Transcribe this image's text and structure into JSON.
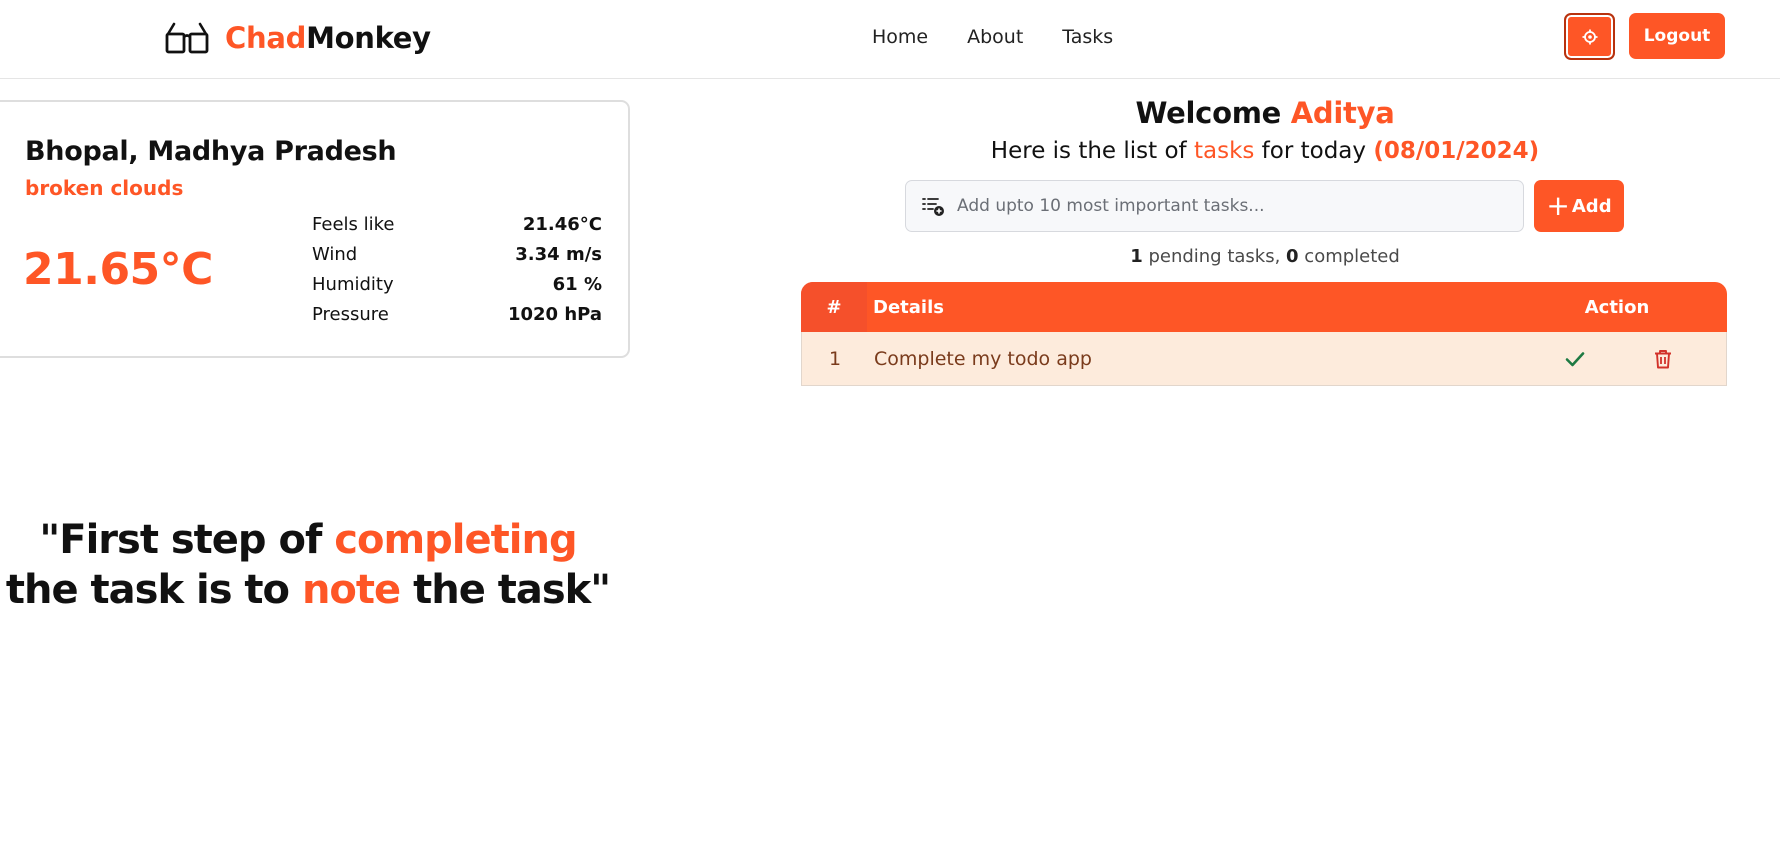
{
  "app": {
    "brand_part1": "Chad",
    "brand_part2": "Monkey",
    "accent_color": "#fe5626"
  },
  "nav": {
    "items": [
      {
        "label": "Home"
      },
      {
        "label": "About"
      },
      {
        "label": "Tasks"
      }
    ],
    "locate_icon": "crosshair-icon",
    "logout_label": "Logout"
  },
  "weather": {
    "city": "Bhopal, Madhya Pradesh",
    "description": "broken clouds",
    "temperature": "21.65°C",
    "stats": [
      {
        "label": "Feels like",
        "value": "21.46°C"
      },
      {
        "label": "Wind",
        "value": "3.34 m/s"
      },
      {
        "label": "Humidity",
        "value": "61 %"
      },
      {
        "label": "Pressure",
        "value": "1020 hPa"
      }
    ]
  },
  "quote": {
    "part1": "\"First step of ",
    "highlight1": "completing",
    "part2": " the task is to ",
    "highlight2": "note",
    "part3": " the task\""
  },
  "main": {
    "welcome_prefix": "Welcome ",
    "user_name": "Aditya",
    "subtitle_prefix": "Here is the list of ",
    "subtitle_highlight": "tasks",
    "subtitle_mid": " for today ",
    "date": "(08/01/2024)",
    "input_placeholder": "Add upto 10 most important tasks...",
    "input_value": "",
    "add_label": "Add",
    "pending_count": "1",
    "pending_label": " pending tasks, ",
    "completed_count": "0",
    "completed_label": " completed"
  },
  "table": {
    "columns": {
      "num": "#",
      "details": "Details",
      "action": "Action"
    },
    "rows": [
      {
        "num": "1",
        "details": "Complete my todo app"
      }
    ]
  }
}
